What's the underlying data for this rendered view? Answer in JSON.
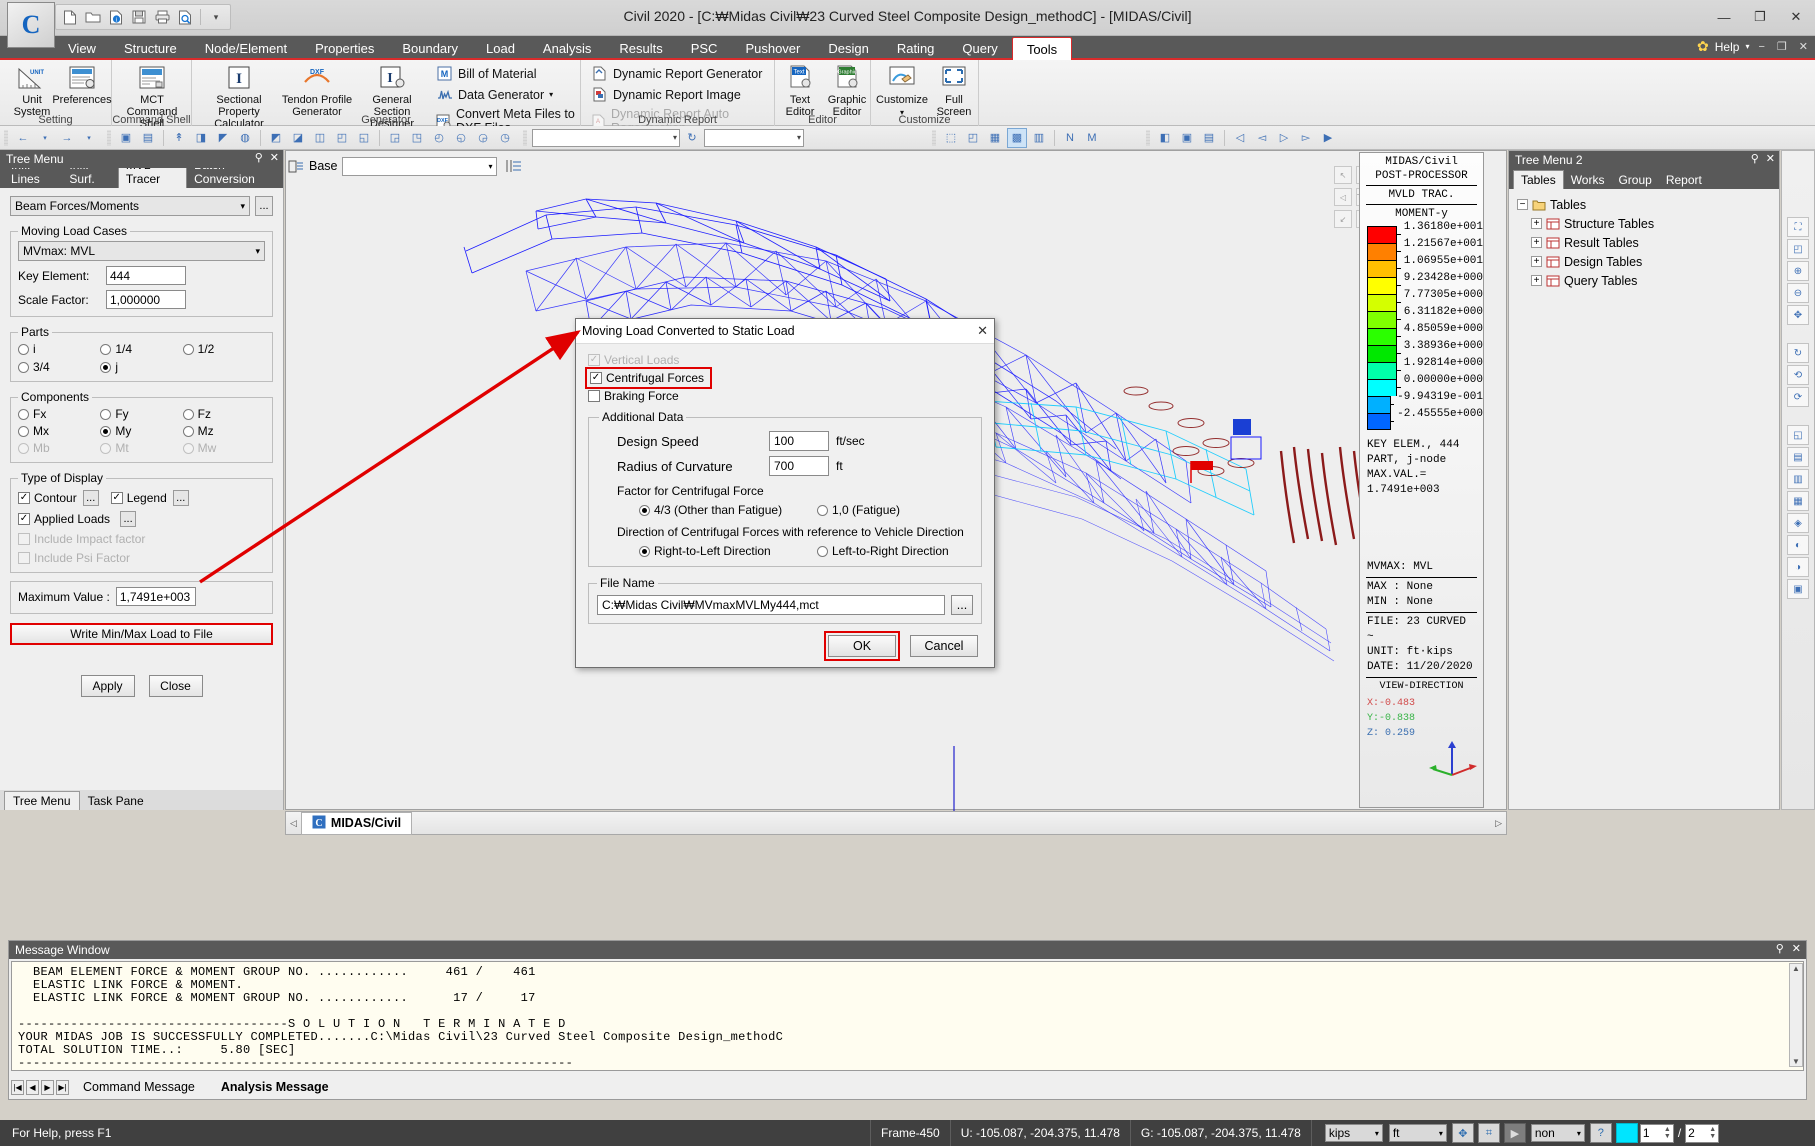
{
  "window": {
    "title": "Civil 2020 - [C:₩Midas Civil₩23 Curved Steel Composite Design_methodC] - [MIDAS/Civil]",
    "minimize": "—",
    "maximize": "❐",
    "close": "✕"
  },
  "quick_access": {
    "items": [
      "new-icon",
      "open-icon",
      "info-icon",
      "save-icon",
      "print-icon",
      "preview-icon"
    ],
    "more": "▾"
  },
  "menu": {
    "items": [
      "View",
      "Structure",
      "Node/Element",
      "Properties",
      "Boundary",
      "Load",
      "Analysis",
      "Results",
      "PSC",
      "Pushover",
      "Design",
      "Rating",
      "Query",
      "Tools"
    ],
    "active": "Tools",
    "help_label": "Help",
    "help_caret": "▾",
    "win_min": "−",
    "win_restore": "❐",
    "win_close": "✕"
  },
  "ribbon": {
    "groups": [
      {
        "label": "Setting",
        "buttons": [
          {
            "label1": "Unit",
            "label2": "System",
            "icon": "unit-system-icon"
          },
          {
            "label1": "Preferences",
            "label2": "",
            "icon": "preferences-icon"
          }
        ]
      },
      {
        "label": "Command Shell",
        "buttons": [
          {
            "label1": "MCT Command",
            "label2": "Shell",
            "icon": "mct-shell-icon"
          }
        ]
      },
      {
        "label": "Generator",
        "buttons": [
          {
            "label1": "Sectional Property",
            "label2": "Calculator",
            "icon": "section-calculator-icon"
          },
          {
            "label1": "Tendon Profile",
            "label2": "Generator",
            "icon": "tendon-profile-icon"
          },
          {
            "label1": "General Section",
            "label2": "Designer",
            "icon": "general-section-icon"
          }
        ],
        "small": [
          {
            "label": "Bill of Material",
            "icon": "bill-of-material-icon",
            "disabled": false
          },
          {
            "label": "Data Generator",
            "icon": "data-generator-icon",
            "caret": "▾",
            "disabled": false
          },
          {
            "label": "Convert Meta Files to DXF Files",
            "icon": "dxf-convert-icon",
            "disabled": false
          }
        ]
      },
      {
        "label": "Dynamic Report",
        "small": [
          {
            "label": "Dynamic Report Generator",
            "icon": "report-generator-icon",
            "disabled": false
          },
          {
            "label": "Dynamic Report Image",
            "icon": "report-image-icon",
            "disabled": false
          },
          {
            "label": "Dynamic Report Auto Regeneration",
            "icon": "report-auto-icon",
            "disabled": true
          }
        ]
      },
      {
        "label": "Editor",
        "buttons": [
          {
            "label1": "Text",
            "label2": "Editor",
            "icon": "text-editor-icon"
          },
          {
            "label1": "Graphic",
            "label2": "Editor",
            "icon": "graphic-editor-icon"
          }
        ]
      },
      {
        "label": "Customize",
        "buttons": [
          {
            "label1": "Customize",
            "label2": "▾",
            "icon": "customize-icon"
          },
          {
            "label1": "Full",
            "label2": "Screen",
            "icon": "full-screen-icon"
          }
        ]
      }
    ]
  },
  "tree_menu": {
    "title": "Tree Menu",
    "pin": "📌",
    "close": "✕",
    "tabs": [
      "Infl. Lines",
      "Infl. Surf.",
      "MVL Tracer",
      "Batch Conversion"
    ],
    "active_tab": "MVL Tracer",
    "result_type": "Beam Forces/Moments",
    "result_type_more": "...",
    "moving_load_cases": {
      "legend": "Moving Load Cases",
      "case": "MVmax: MVL",
      "key_element_label": "Key Element:",
      "key_element_value": "444",
      "scale_factor_label": "Scale Factor:",
      "scale_factor_value": "1,000000"
    },
    "parts": {
      "legend": "Parts",
      "options": [
        {
          "label": "i",
          "selected": false
        },
        {
          "label": "1/4",
          "selected": false
        },
        {
          "label": "1/2",
          "selected": false
        },
        {
          "label": "3/4",
          "selected": false
        },
        {
          "label": "j",
          "selected": true
        }
      ]
    },
    "components": {
      "legend": "Components",
      "options": [
        {
          "label": "Fx",
          "selected": false,
          "disabled": false
        },
        {
          "label": "Fy",
          "selected": false,
          "disabled": false
        },
        {
          "label": "Fz",
          "selected": false,
          "disabled": false
        },
        {
          "label": "Mx",
          "selected": false,
          "disabled": false
        },
        {
          "label": "My",
          "selected": true,
          "disabled": false
        },
        {
          "label": "Mz",
          "selected": false,
          "disabled": false
        },
        {
          "label": "Mb",
          "selected": false,
          "disabled": true
        },
        {
          "label": "Mt",
          "selected": false,
          "disabled": true
        },
        {
          "label": "Mw",
          "selected": false,
          "disabled": true
        }
      ]
    },
    "type_of_display": {
      "legend": "Type of Display",
      "contour": {
        "label": "Contour",
        "checked": true,
        "more": "..."
      },
      "legend_cb": {
        "label": "Legend",
        "checked": true,
        "more": "..."
      },
      "applied_loads": {
        "label": "Applied Loads",
        "checked": true,
        "more": "..."
      },
      "include_impact": {
        "label": "Include Impact factor",
        "checked": false,
        "disabled": true
      },
      "include_psi": {
        "label": "Include Psi Factor",
        "checked": false,
        "disabled": true
      }
    },
    "maximum_value_label": "Maximum Value :",
    "maximum_value": "1,7491e+003",
    "write_button": "Write Min/Max Load to File",
    "apply_button": "Apply",
    "close_button": "Close",
    "bottom_tabs": [
      "Tree Menu",
      "Task Pane"
    ],
    "bottom_active": "Tree Menu"
  },
  "viewport": {
    "base_label": "Base",
    "base_caret": "▾"
  },
  "legend": {
    "line1": "MIDAS/Civil",
    "line2": "POST-PROCESSOR",
    "line3": "MVLD TRAC.",
    "line4": "MOMENT-y",
    "values": [
      "1.36180e+001",
      "1.21567e+001",
      "1.06955e+001",
      "9.23428e+000",
      "7.77305e+000",
      "6.31182e+000",
      "4.85059e+000",
      "3.38936e+000",
      "1.92814e+000",
      "0.00000e+000",
      "-9.94319e-001",
      "-2.45555e+000"
    ],
    "colors": [
      "#ff0000",
      "#ff8000",
      "#ffbf00",
      "#ffff00",
      "#d4ff00",
      "#80ff00",
      "#2bff00",
      "#00e800",
      "#00ffaa",
      "#00ffff",
      "#00b0ff",
      "#0066ff"
    ],
    "info": [
      "KEY ELEM., 444",
      "PART, j-node",
      "MAX.VAL.=",
      "1.7491e+003"
    ],
    "case": "MVMAX: MVL",
    "max_line": "MAX : None",
    "min_line": "MIN : None",
    "file_line": "FILE: 23 CURVED ~",
    "unit_line": "UNIT: ft·kips",
    "date_line": "DATE: 11/20/2020",
    "view_direction_label": "VIEW-DIRECTION",
    "vd_x": "X:-0.483",
    "vd_y": "Y:-0.838",
    "vd_z": "Z: 0.259"
  },
  "tree_menu_2": {
    "title": "Tree Menu 2",
    "pin": "📌",
    "close": "✕",
    "tabs": [
      "Tables",
      "Works",
      "Group",
      "Report"
    ],
    "active_tab": "Tables",
    "root": "Tables",
    "nodes": [
      "Structure Tables",
      "Result Tables",
      "Design Tables",
      "Query Tables"
    ]
  },
  "doc_tabs": {
    "left_arrow": "◁",
    "right_arrow": "▷",
    "tab": "MIDAS/Civil",
    "icon": "civil-doc-icon"
  },
  "message_window": {
    "title": "Message Window",
    "pin": "📌",
    "close": "✕",
    "lines": [
      "  BEAM ELEMENT FORCE & MOMENT GROUP NO. ............     461 /    461",
      "  ELASTIC LINK FORCE & MOMENT.",
      "  ELASTIC LINK FORCE & MOMENT GROUP NO. ............      17 /     17",
      "",
      "------------------------------------S O L U T I O N   T E R M I N A T E D",
      "YOUR MIDAS JOB IS SUCCESSFULLY COMPLETED.......C:\\Midas Civil\\23 Curved Steel Composite Design_methodC",
      "TOTAL SOLUTION TIME..:     5.80 [SEC]",
      "--------------------------------------------------------------------------"
    ],
    "tabs": [
      "Command Message",
      "Analysis Message"
    ],
    "active_tab": "Analysis Message"
  },
  "status_bar": {
    "help_text": "For Help, press F1",
    "frame": "Frame-450",
    "u_coords": "U: -105.087, -204.375, 11.478",
    "g_coords": "G: -105.087, -204.375, 11.478",
    "force_unit": "kips",
    "length_unit": "ft",
    "snap_mode": "non",
    "page_current": "1",
    "page_total": "2",
    "separator": "/"
  },
  "dialog": {
    "title": "Moving Load Converted to Static Load",
    "close": "✕",
    "vertical_loads": {
      "label": "Vertical Loads",
      "checked": true,
      "disabled": true
    },
    "centrifugal_forces": {
      "label": "Centrifugal Forces",
      "checked": true,
      "highlighted": true
    },
    "braking_force": {
      "label": "Braking Force",
      "checked": false
    },
    "additional_data": {
      "legend": "Additional Data",
      "design_speed_label": "Design Speed",
      "design_speed_value": "100",
      "design_speed_unit": "ft/sec",
      "radius_label": "Radius of Curvature",
      "radius_value": "700",
      "radius_unit": "ft",
      "factor_label": "Factor for Centrifugal Force",
      "factor_options": [
        {
          "label": "4/3 (Other than Fatigue)",
          "selected": true
        },
        {
          "label": "1,0 (Fatigue)",
          "selected": false
        }
      ],
      "direction_label": "Direction of Centrifugal Forces with reference to Vehicle Direction",
      "direction_options": [
        {
          "label": "Right-to-Left Direction",
          "selected": true
        },
        {
          "label": "Left-to-Right Direction",
          "selected": false
        }
      ]
    },
    "file_name": {
      "legend": "File Name",
      "value": "C:₩Midas Civil₩MVmaxMVLMy444,mct",
      "browse": "..."
    },
    "ok_button": "OK",
    "cancel_button": "Cancel"
  },
  "annotation": {
    "highlight_color": "#e00000"
  }
}
